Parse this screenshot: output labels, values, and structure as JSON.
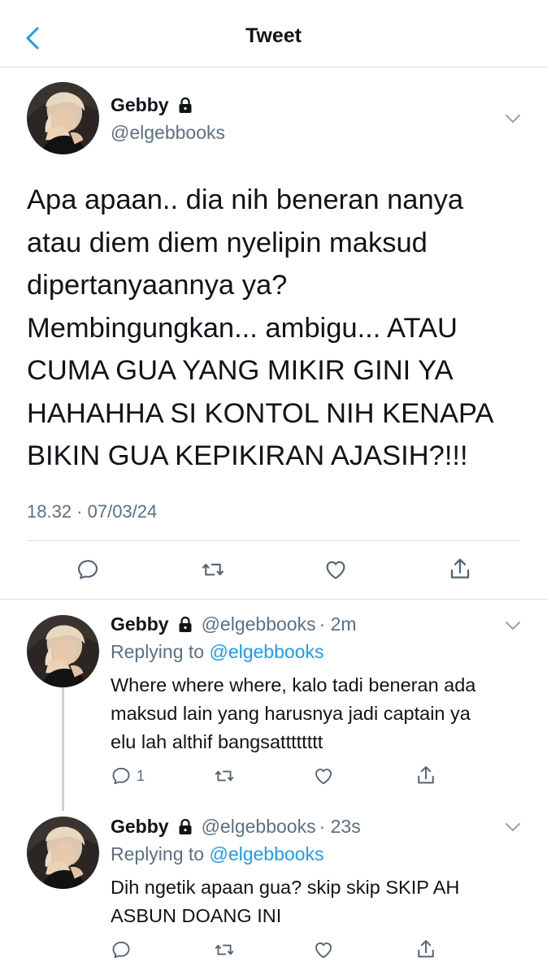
{
  "header": {
    "title": "Tweet"
  },
  "main_tweet": {
    "name": "Gebby",
    "handle": "@elgebbooks",
    "text": "Apa apaan.. dia nih beneran nanya\natau diem diem nyelipin maksud\ndipertanyaannya ya?\nMembingungkan... ambigu... ATAU\nCUMA GUA YANG MIKIR GINI YA\nHAHAHHA SI KONTOL NIH KENAPA\nBIKIN GUA KEPIKIRAN AJASIH?!!!",
    "timestamp": "18.32 · 07/03/24"
  },
  "replies": [
    {
      "name": "Gebby",
      "handle": "@elgebbooks",
      "time": "· 2m",
      "replying_label": "Replying to",
      "replying_handle": "@elgebbooks",
      "text": "Where where where, kalo tadi beneran ada\nmaksud lain yang harusnya jadi captain ya\nelu lah althif bangsatttttttt",
      "reply_count": "1"
    },
    {
      "name": "Gebby",
      "handle": "@elgebbooks",
      "time": "· 23s",
      "replying_label": "Replying to",
      "replying_handle": "@elgebbooks",
      "text": "Dih ngetik apaan gua? skip skip SKIP AH\nASBUN DOANG INI",
      "reply_count": ""
    }
  ],
  "colors": {
    "link": "#1d9bf0",
    "muted": "#5b7083",
    "text": "#0f1419",
    "divider": "#dcdfe2"
  },
  "icons": [
    "back-chevron-icon",
    "lock-icon",
    "chevron-down-icon",
    "reply-icon",
    "retweet-icon",
    "like-icon",
    "share-icon"
  ]
}
